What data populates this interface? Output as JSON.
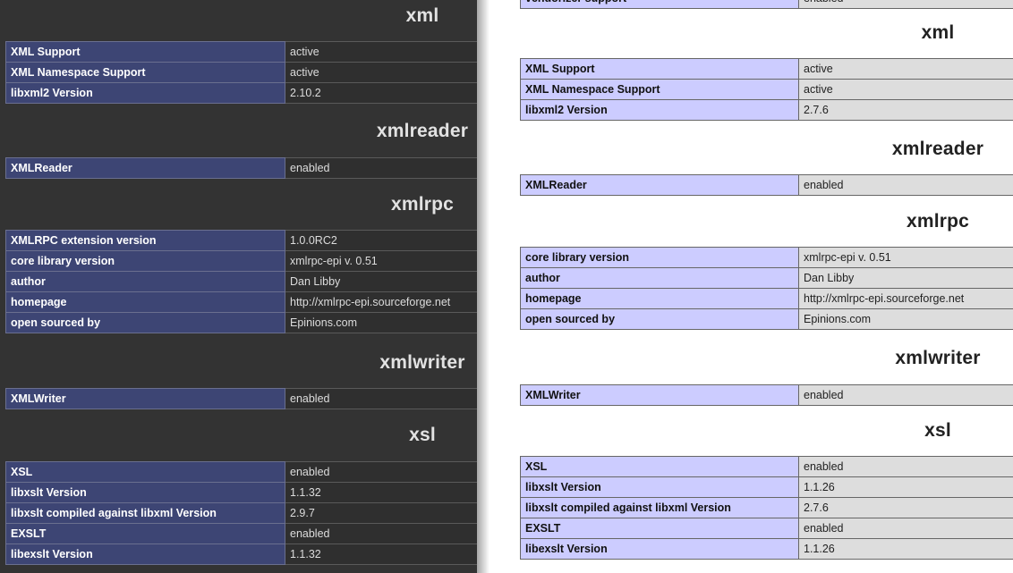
{
  "left": {
    "xml": {
      "title": "xml",
      "rows": [
        {
          "key": "XML Support",
          "value": "active"
        },
        {
          "key": "XML Namespace Support",
          "value": "active"
        },
        {
          "key": "libxml2 Version",
          "value": "2.10.2"
        }
      ]
    },
    "xmlreader": {
      "title": "xmlreader",
      "rows": [
        {
          "key": "XMLReader",
          "value": "enabled"
        }
      ]
    },
    "xmlrpc": {
      "title": "xmlrpc",
      "rows": [
        {
          "key": "XMLRPC extension version",
          "value": "1.0.0RC2"
        },
        {
          "key": "core library version",
          "value": "xmlrpc-epi v. 0.51"
        },
        {
          "key": "author",
          "value": "Dan Libby"
        },
        {
          "key": "homepage",
          "value": "http://xmlrpc-epi.sourceforge.net"
        },
        {
          "key": "open sourced by",
          "value": "Epinions.com"
        }
      ]
    },
    "xmlwriter": {
      "title": "xmlwriter",
      "rows": [
        {
          "key": "XMLWriter",
          "value": "enabled"
        }
      ]
    },
    "xsl": {
      "title": "xsl",
      "rows": [
        {
          "key": "XSL",
          "value": "enabled"
        },
        {
          "key": "libxslt Version",
          "value": "1.1.32"
        },
        {
          "key": "libxslt compiled against libxml Version",
          "value": "2.9.7"
        },
        {
          "key": "EXSLT",
          "value": "enabled"
        },
        {
          "key": "libexslt Version",
          "value": "1.1.32"
        }
      ]
    }
  },
  "right": {
    "top_stub": {
      "key": "vendorizer support",
      "value": "enabled"
    },
    "xml": {
      "title": "xml",
      "rows": [
        {
          "key": "XML Support",
          "value": "active"
        },
        {
          "key": "XML Namespace Support",
          "value": "active"
        },
        {
          "key": "libxml2 Version",
          "value": "2.7.6"
        }
      ]
    },
    "xmlreader": {
      "title": "xmlreader",
      "rows": [
        {
          "key": "XMLReader",
          "value": "enabled"
        }
      ]
    },
    "xmlrpc": {
      "title": "xmlrpc",
      "rows": [
        {
          "key": "core library version",
          "value": "xmlrpc-epi v. 0.51"
        },
        {
          "key": "author",
          "value": "Dan Libby"
        },
        {
          "key": "homepage",
          "value": "http://xmlrpc-epi.sourceforge.net"
        },
        {
          "key": "open sourced by",
          "value": "Epinions.com"
        }
      ]
    },
    "xmlwriter": {
      "title": "xmlwriter",
      "rows": [
        {
          "key": "XMLWriter",
          "value": "enabled"
        }
      ]
    },
    "xsl": {
      "title": "xsl",
      "rows": [
        {
          "key": "XSL",
          "value": "enabled"
        },
        {
          "key": "libxslt Version",
          "value": "1.1.26"
        },
        {
          "key": "libxslt compiled against libxml Version",
          "value": "2.7.6"
        },
        {
          "key": "EXSLT",
          "value": "enabled"
        },
        {
          "key": "libexslt Version",
          "value": "1.1.26"
        }
      ]
    }
  },
  "colors": {
    "dark_background": "#333333",
    "dark_key_cell": "#3d4574",
    "light_key_cell": "#ccccff",
    "light_value_cell": "#dddddd"
  }
}
